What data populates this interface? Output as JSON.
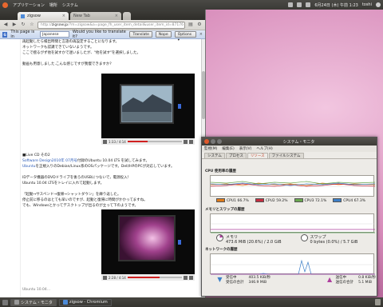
{
  "top_panel": {
    "menus": [
      "アプリケーション",
      "場所",
      "システム"
    ],
    "clock": "6月24日 (木) 午前 1:23",
    "user": "toshi",
    "volume_icon": "speaker-icon",
    "network_icon": "network-icon",
    "mail_icon": "mail-icon"
  },
  "browser": {
    "tabs": [
      {
        "label": "zigsow",
        "active": true
      },
      {
        "label": "New Tab",
        "active": false
      }
    ],
    "url_host": "http://",
    "url_main": "zigsow.jp",
    "url_rest": "/?m=zigsow&a=page_fh_user_item_detail&user_item_id=87176",
    "translate_bar": {
      "prefix": "This page is in",
      "language": "Japanese",
      "question": "Would you like to translate it?",
      "translate_btn": "Translate",
      "nope_btn": "Nope",
      "options_btn": "Options ▾",
      "close": "×"
    },
    "article": {
      "lines_top": [
        "再起動したら検出時間と言語の再設定することになります。",
        "ネットワークも認識できていないようです。",
        "ここで揺るがず他を試すかで迷いましたが、\"他を試す\"を選択しました。",
        "",
        "動画も用意しました.こんな感じですが我慢できますか?"
      ],
      "video1_time": "1:33 / 4:14",
      "section_title": "■Live CD その2",
      "link_line_1": "Software Design2010年 07月号",
      "line_1_rest": "付録のUbuntu 10.04 LTS を試してみます。",
      "link_line_2": "Ubuntu",
      "line_2_rest": "を正規入りのDebian/Linux系のOSパッケージです。Dell/HPのPCが対応しています。",
      "line_3": "",
      "line_4": "IDデータ機器のDVDドライブを後ろのUSBにつないで，電源投入！",
      "line_5": "Ubuntu 10.04 LTSをトレイに入れて起動します。",
      "line_6": "",
      "line_7": "「起動→サスペンド→復帰→シャットダウン」を繰り返した。",
      "line_8": "停止前に移るのはとても早いのですが、起動と復帰に時間がかかってますね。",
      "line_9": "でも、Windowsとかってデスクトップが出るのが立って下のようです。",
      "video2_time": "2:28 / 4:14",
      "bottom_line": "Ubuntu 10.04..."
    }
  },
  "monitor": {
    "title": "システム・モニタ",
    "menu": [
      "監視(M)",
      "編集(E)",
      "表示(V)",
      "ヘルプ(H)"
    ],
    "tabs": [
      "システム",
      "プロセス",
      "リソース",
      "ファイルシステム"
    ],
    "active_tab": 2,
    "cpu_title": "CPU 使用率の履歴",
    "cpu_legend": [
      {
        "label": "CPU1",
        "value": "66.7%",
        "color": "#e07b1a"
      },
      {
        "label": "CPU2",
        "value": "59.2%",
        "color": "#c62e40"
      },
      {
        "label": "CPU3",
        "value": "72.1%",
        "color": "#6aa84f"
      },
      {
        "label": "CPU4",
        "value": "67.3%",
        "color": "#3d7fc8"
      }
    ],
    "cpu_ticks": [
      "100 %",
      "50 %",
      "0 %"
    ],
    "mem_title": "メモリとスワップの履歴",
    "mem_ticks": [
      "100 %",
      "50 %",
      "0 %"
    ],
    "memory": {
      "label": "メモリ",
      "value": "473.6 MiB (20.6%) / 2.0 GiB",
      "color": "#ae3f9e"
    },
    "swap": {
      "label": "スワップ",
      "value": "0 bytes (0.0%) / 5.7 GiB",
      "color": "#3f8f3f"
    },
    "net_title": "ネットワークの履歴",
    "net_ticks": [
      "1.2 KiB/s",
      "0.6 KiB/s",
      "0 bytes/s"
    ],
    "receive": {
      "label": "受信中",
      "total_label": "受信の合計",
      "rate": "403.5 KiB/秒",
      "total": "346.9 MiB"
    },
    "send": {
      "label": "送信中",
      "total_label": "送信の合計",
      "rate": "0.8 KiB/秒",
      "total": "5.1 MiB"
    }
  },
  "bottom_panel": {
    "tasks": [
      "システム・モニタ",
      "zigsow - Chromium"
    ]
  }
}
